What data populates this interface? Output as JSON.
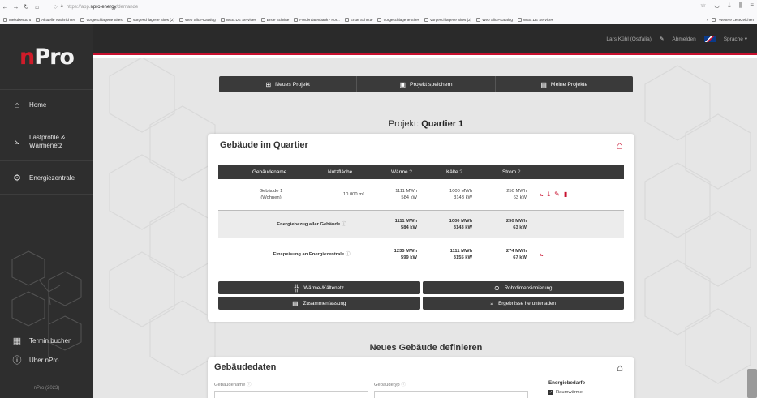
{
  "browser": {
    "url_prefix": "https://app.",
    "url_host": "npro.energy",
    "url_path": "/demande",
    "bookmarks": [
      "Meistbesucht",
      "Aktuelle Nachrichten",
      "Vorgeschlagene Sites",
      "Vorgeschlagene Sites (2)",
      "Web Slice-Katalog",
      "WEB.DE Services",
      "Erste Schritte",
      "Förderdatenbank - För...",
      "Erste Schritte",
      "Vorgeschlagene Sites",
      "Vorgeschlagene Sites (2)",
      "Web Slice-Katalog",
      "WEB.DE Services"
    ],
    "bookmarks_more": "Weitere Lesezeichen"
  },
  "header": {
    "user": "Lars Kühl (Ostfalia)",
    "logout": "Abmelden",
    "language": "Sprache"
  },
  "sidebar": {
    "logo_n": "n",
    "logo_rest": "Pro",
    "items": [
      {
        "label": "Home",
        "icon": "home-icon"
      },
      {
        "label": "Lastprofile &",
        "label2": "Wärmenetz",
        "icon": "chart-icon"
      },
      {
        "label": "Energiezentrale",
        "icon": "gear-icon"
      }
    ],
    "bottom_items": [
      {
        "label": "Termin buchen",
        "icon": "calendar-icon"
      },
      {
        "label": "Über nPro",
        "icon": "info-icon"
      }
    ],
    "footer": "nPro (2023)"
  },
  "actions": {
    "new_project": "Neues Projekt",
    "save_project": "Projekt speichern",
    "my_projects": "Meine Projekte"
  },
  "project": {
    "label": "Projekt:",
    "name": "Quartier 1"
  },
  "buildings": {
    "title": "Gebäude im Quartier",
    "columns": {
      "name": "Gebäudename",
      "area": "Nutzfläche",
      "heat": "Wärme",
      "cold": "Kälte",
      "power": "Strom",
      "help": "?"
    },
    "rows": [
      {
        "name": "Gebäude 1",
        "type": "(Wohnen)",
        "area": "10.000 m²",
        "heat_energy": "1111 MWh",
        "heat_power": "584 kW",
        "cold_energy": "1000 MWh",
        "cold_power": "3143 kW",
        "power_energy": "250 MWh",
        "power_power": "63 kW"
      }
    ],
    "total": {
      "label": "Energiebezug aller Gebäude",
      "heat_energy": "1111 MWh",
      "heat_power": "584 kW",
      "cold_energy": "1000 MWh",
      "cold_power": "3143 kW",
      "power_energy": "250 MWh",
      "power_power": "63 kW"
    },
    "feed": {
      "label": "Einspeisung an Energiezentrale",
      "heat_energy": "1235 MWh",
      "heat_power": "599 kW",
      "cold_energy": "1111 MWh",
      "cold_power": "3155 kW",
      "power_energy": "274 MWh",
      "power_power": "67 kW"
    },
    "buttons": {
      "network": "Wärme-/Kältenetz",
      "pipe": "Rohrdimensionierung",
      "summary": "Zusammenfassung",
      "download": "Ergebnisse herunterladen"
    }
  },
  "new_building": {
    "title": "Neues Gebäude definieren",
    "card_title": "Gebäudedaten",
    "name_label": "Gebäudename",
    "type_label": "Gebäudetyp",
    "demand_label": "Energiebedarfe",
    "demand_option": "Raumwärme"
  },
  "colors": {
    "accent": "#c8102e",
    "dark": "#3a3a3a",
    "sidebar": "#2e2e2e"
  }
}
